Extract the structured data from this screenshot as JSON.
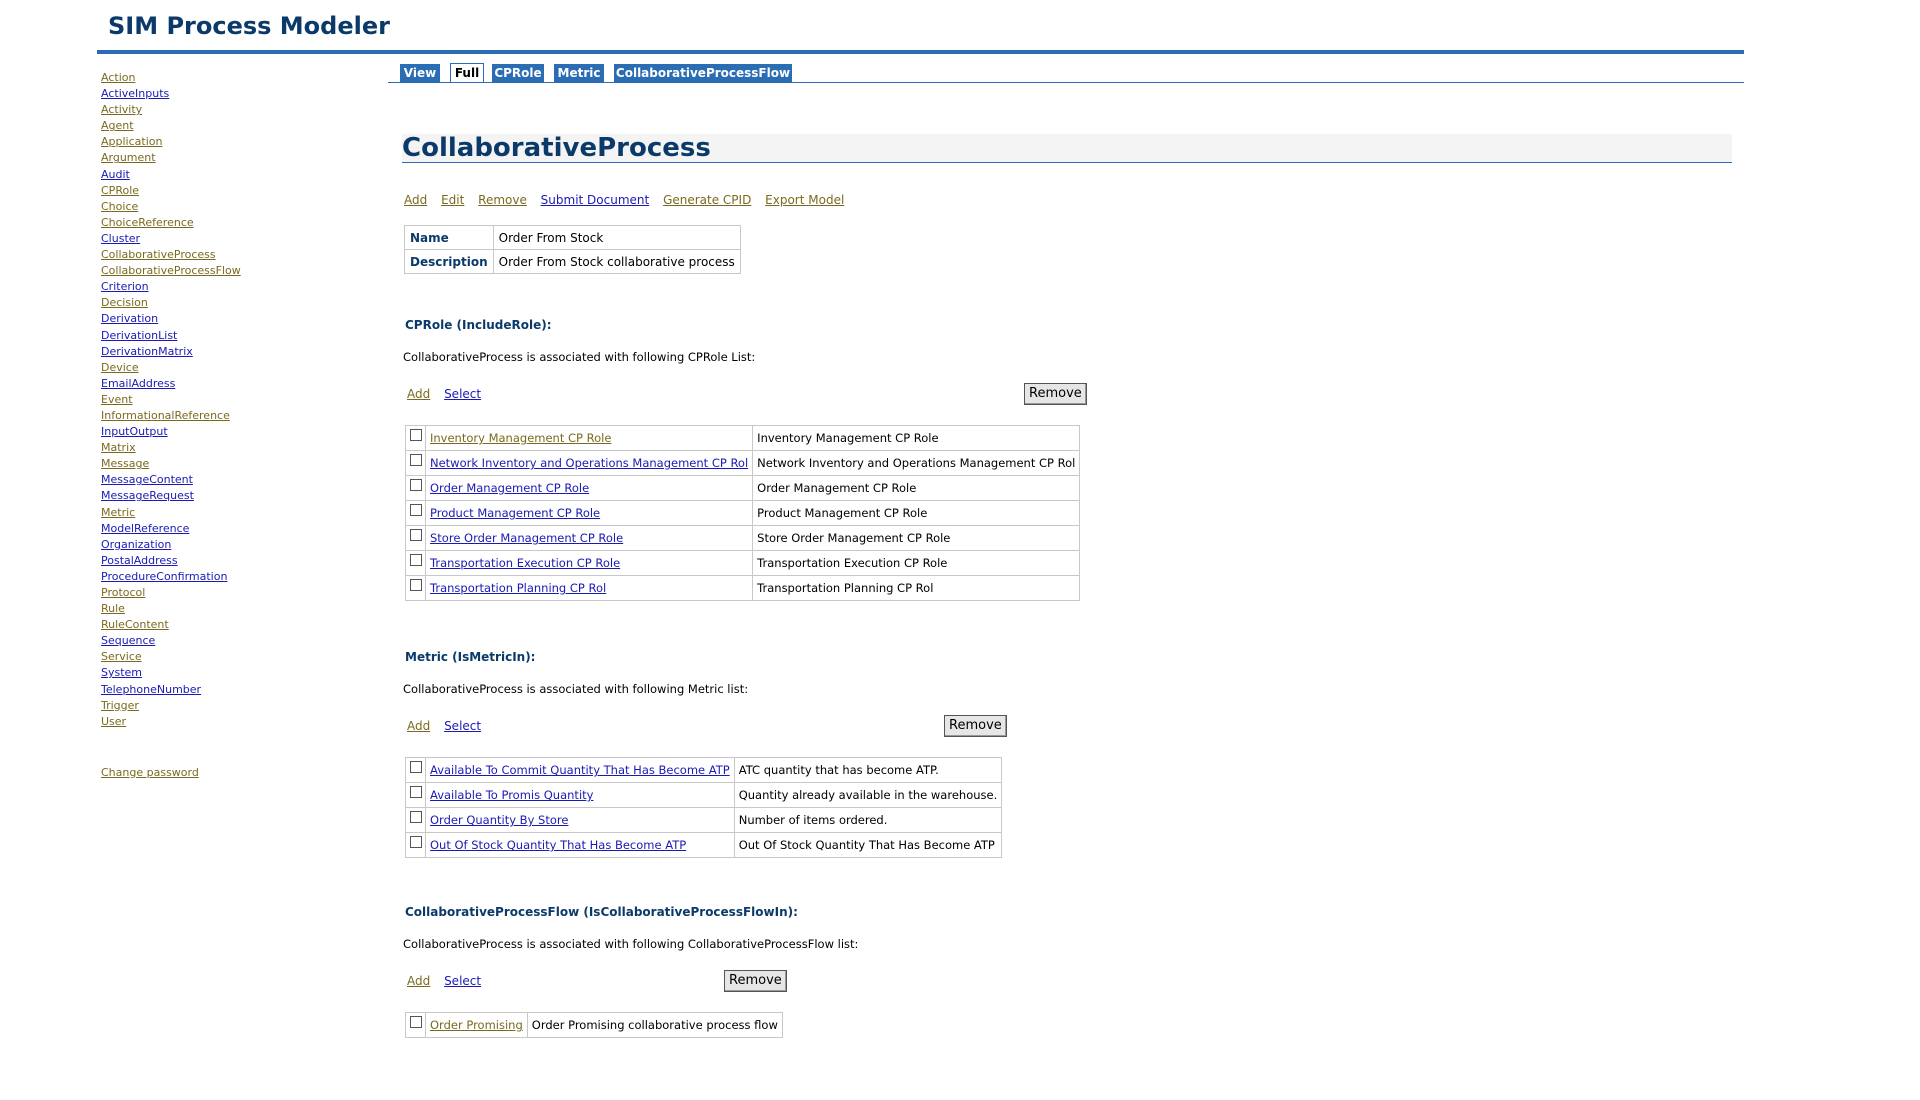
{
  "app": {
    "title": "SIM Process Modeler"
  },
  "tabs": [
    {
      "label": "View",
      "active": false
    },
    {
      "label": "Full",
      "active": true
    },
    {
      "label": "CPRole",
      "active": false
    },
    {
      "label": "Metric",
      "active": false
    },
    {
      "label": "CollaborativeProcessFlow",
      "active": false
    }
  ],
  "sidebar": {
    "items": [
      {
        "label": "Action",
        "color": "olive"
      },
      {
        "label": "ActiveInputs",
        "color": "blue"
      },
      {
        "label": "Activity",
        "color": "olive"
      },
      {
        "label": "Agent",
        "color": "olive"
      },
      {
        "label": "Application",
        "color": "olive"
      },
      {
        "label": "Argument",
        "color": "olive"
      },
      {
        "label": "Audit",
        "color": "blue"
      },
      {
        "label": "CPRole",
        "color": "olive"
      },
      {
        "label": "Choice",
        "color": "olive"
      },
      {
        "label": "ChoiceReference",
        "color": "olive"
      },
      {
        "label": "Cluster",
        "color": "blue"
      },
      {
        "label": "CollaborativeProcess",
        "color": "olive"
      },
      {
        "label": "CollaborativeProcessFlow",
        "color": "olive"
      },
      {
        "label": "Criterion",
        "color": "blue"
      },
      {
        "label": "Decision",
        "color": "olive"
      },
      {
        "label": "Derivation",
        "color": "blue"
      },
      {
        "label": "DerivationList",
        "color": "blue"
      },
      {
        "label": "DerivationMatrix",
        "color": "blue"
      },
      {
        "label": "Device",
        "color": "olive"
      },
      {
        "label": "EmailAddress",
        "color": "blue"
      },
      {
        "label": "Event",
        "color": "olive"
      },
      {
        "label": "InformationalReference",
        "color": "olive"
      },
      {
        "label": "InputOutput",
        "color": "blue"
      },
      {
        "label": "Matrix",
        "color": "olive"
      },
      {
        "label": "Message",
        "color": "olive"
      },
      {
        "label": "MessageContent",
        "color": "blue"
      },
      {
        "label": "MessageRequest",
        "color": "blue"
      },
      {
        "label": "Metric",
        "color": "olive"
      },
      {
        "label": "ModelReference",
        "color": "blue"
      },
      {
        "label": "Organization",
        "color": "blue"
      },
      {
        "label": "PostalAddress",
        "color": "blue"
      },
      {
        "label": "ProcedureConfirmation",
        "color": "blue"
      },
      {
        "label": "Protocol",
        "color": "olive"
      },
      {
        "label": "Rule",
        "color": "olive"
      },
      {
        "label": "RuleContent",
        "color": "olive"
      },
      {
        "label": "Sequence",
        "color": "blue"
      },
      {
        "label": "Service",
        "color": "olive"
      },
      {
        "label": "System",
        "color": "blue"
      },
      {
        "label": "TelephoneNumber",
        "color": "blue"
      },
      {
        "label": "Trigger",
        "color": "olive"
      },
      {
        "label": "User",
        "color": "olive"
      }
    ],
    "change_password": "Change password"
  },
  "page": {
    "title": "CollaborativeProcess",
    "actions": [
      "Add",
      "Edit",
      "Remove",
      "Submit Document",
      "Generate CPID",
      "Export Model"
    ],
    "properties": [
      {
        "key": "Name",
        "value": "Order From Stock"
      },
      {
        "key": "Description",
        "value": "Order From Stock collaborative process"
      }
    ]
  },
  "sections": {
    "cprole": {
      "title": "CPRole (IncludeRole):",
      "desc": "CollaborativeProcess is associated with following CPRole List:",
      "add": "Add",
      "select": "Select",
      "remove": "Remove",
      "rows": [
        {
          "link": "Inventory Management CP Role",
          "desc": "Inventory Management CP Role",
          "color": "olive"
        },
        {
          "link": "Network Inventory and Operations Management CP Rol",
          "desc": "Network Inventory and Operations Management CP Rol",
          "color": "blue"
        },
        {
          "link": "Order Management CP Role",
          "desc": "Order Management CP Role",
          "color": "blue"
        },
        {
          "link": "Product Management CP Role",
          "desc": "Product Management CP Role",
          "color": "blue"
        },
        {
          "link": "Store Order Management CP Role",
          "desc": "Store Order Management CP Role",
          "color": "blue"
        },
        {
          "link": "Transportation Execution CP Role",
          "desc": "Transportation Execution CP Role",
          "color": "blue"
        },
        {
          "link": "Transportation Planning CP Rol",
          "desc": "Transportation Planning CP Rol",
          "color": "blue"
        }
      ]
    },
    "metric": {
      "title": "Metric (IsMetricIn):",
      "desc": "CollaborativeProcess is associated with following Metric list:",
      "add": "Add",
      "select": "Select",
      "remove": "Remove",
      "rows": [
        {
          "link": "Available To Commit Quantity That Has Become ATP",
          "desc": "ATC quantity that has become ATP.",
          "color": "blue"
        },
        {
          "link": "Available To Promis Quantity",
          "desc": "Quantity already available in the warehouse.",
          "color": "blue"
        },
        {
          "link": "Order Quantity By Store",
          "desc": "Number of items ordered.",
          "color": "blue"
        },
        {
          "link": "Out Of Stock Quantity That Has Become ATP",
          "desc": "Out Of Stock Quantity That Has Become ATP",
          "color": "blue"
        }
      ]
    },
    "flow": {
      "title": "CollaborativeProcessFlow (IsCollaborativeProcessFlowIn):",
      "desc": "CollaborativeProcess is associated with following CollaborativeProcessFlow list:",
      "add": "Add",
      "select": "Select",
      "remove": "Remove",
      "rows": [
        {
          "link": "Order Promising",
          "desc": "Order Promising collaborative process flow",
          "color": "olive"
        }
      ]
    }
  },
  "colors": {
    "brand": "#2a6db5",
    "heading": "#0b3a6a",
    "link_blue": "#1a1ab5",
    "link_olive": "#7a6a1f"
  }
}
